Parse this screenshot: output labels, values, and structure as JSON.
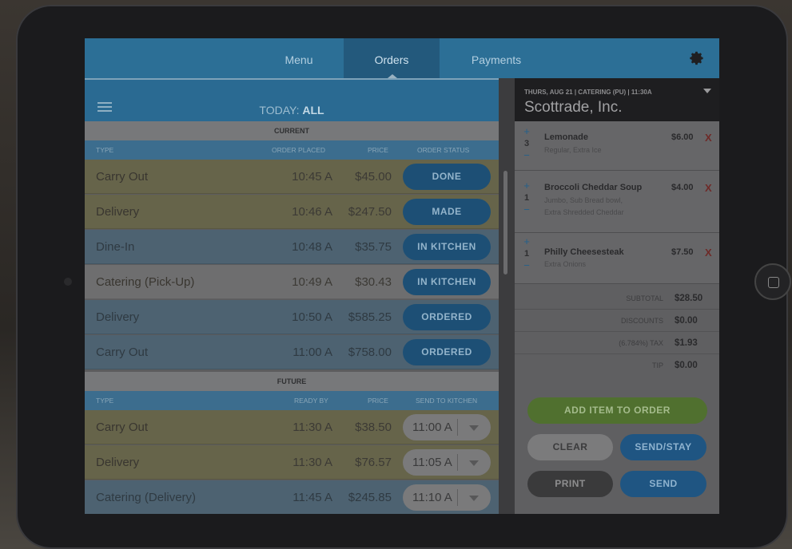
{
  "nav": {
    "tabs": [
      {
        "label": "Menu"
      },
      {
        "label": "Orders"
      },
      {
        "label": "Payments"
      }
    ]
  },
  "orders": {
    "header": {
      "today_prefix": "TODAY:",
      "today_value": "ALL"
    },
    "current": {
      "section_label": "CURRENT",
      "columns": {
        "type": "TYPE",
        "placed": "ORDER PLACED",
        "price": "PRICE",
        "status": "ORDER STATUS"
      },
      "rows": [
        {
          "type": "Carry Out",
          "time": "10:45 A",
          "price": "$45.00",
          "status": "DONE"
        },
        {
          "type": "Delivery",
          "time": "10:46 A",
          "price": "$247.50",
          "status": "MADE"
        },
        {
          "type": "Dine-In",
          "time": "10:48 A",
          "price": "$35.75",
          "status": "IN KITCHEN"
        },
        {
          "type": "Catering (Pick-Up)",
          "time": "10:49 A",
          "price": "$30.43",
          "status": "IN KITCHEN"
        },
        {
          "type": "Delivery",
          "time": "10:50 A",
          "price": "$585.25",
          "status": "ORDERED"
        },
        {
          "type": "Carry Out",
          "time": "11:00 A",
          "price": "$758.00",
          "status": "ORDERED"
        }
      ]
    },
    "future": {
      "section_label": "FUTURE",
      "columns": {
        "type": "TYPE",
        "ready": "READY BY",
        "price": "PRICE",
        "send": "SEND TO KITCHEN"
      },
      "rows": [
        {
          "type": "Carry Out",
          "time": "11:30 A",
          "price": "$38.50",
          "send": "11:00 A"
        },
        {
          "type": "Delivery",
          "time": "11:30 A",
          "price": "$76.57",
          "send": "11:05 A"
        },
        {
          "type": "Catering (Delivery)",
          "time": "11:45 A",
          "price": "$245.85",
          "send": "11:10 A"
        }
      ]
    }
  },
  "ticket": {
    "meta": "THURS, AUG 21 | CATERING (PU) | 11:30A",
    "customer": "Scottrade, Inc.",
    "items": [
      {
        "qty": "3",
        "name": "Lemonade",
        "mods": [
          "Regular, Extra Ice"
        ],
        "price": "$6.00"
      },
      {
        "qty": "1",
        "name": "Broccoli Cheddar Soup",
        "mods": [
          "Jumbo, Sub Bread bowl,",
          "Extra Shredded Cheddar"
        ],
        "price": "$4.00"
      },
      {
        "qty": "1",
        "name": "Philly Cheesesteak",
        "mods": [
          "Extra Onions"
        ],
        "price": "$7.50"
      }
    ],
    "totals": [
      {
        "label": "SUBTOTAL",
        "value": "$28.50"
      },
      {
        "label": "DISCOUNTS",
        "value": "$0.00"
      },
      {
        "label": "(6.784%) TAX",
        "value": "$1.93"
      },
      {
        "label": "TIP",
        "value": "$0.00"
      }
    ],
    "buttons": {
      "add_item": "ADD ITEM TO ORDER",
      "clear": "CLEAR",
      "send_stay": "SEND/STAY",
      "print": "PRINT",
      "send": "SEND"
    },
    "remove_glyph": "X",
    "plus_glyph": "+",
    "minus_glyph": "−"
  },
  "colors": {
    "nav_bar": "#2c6f96",
    "status_pill": "#1d4f75",
    "carry_out_row": "#66644a",
    "dine_in_row": "#4d6271",
    "add_item_green": "#50702f",
    "remove_red": "#6e2a28"
  },
  "icons": {
    "settings": "gear-icon",
    "menu": "hamburger-icon",
    "dropdown": "chevron-down-icon"
  }
}
